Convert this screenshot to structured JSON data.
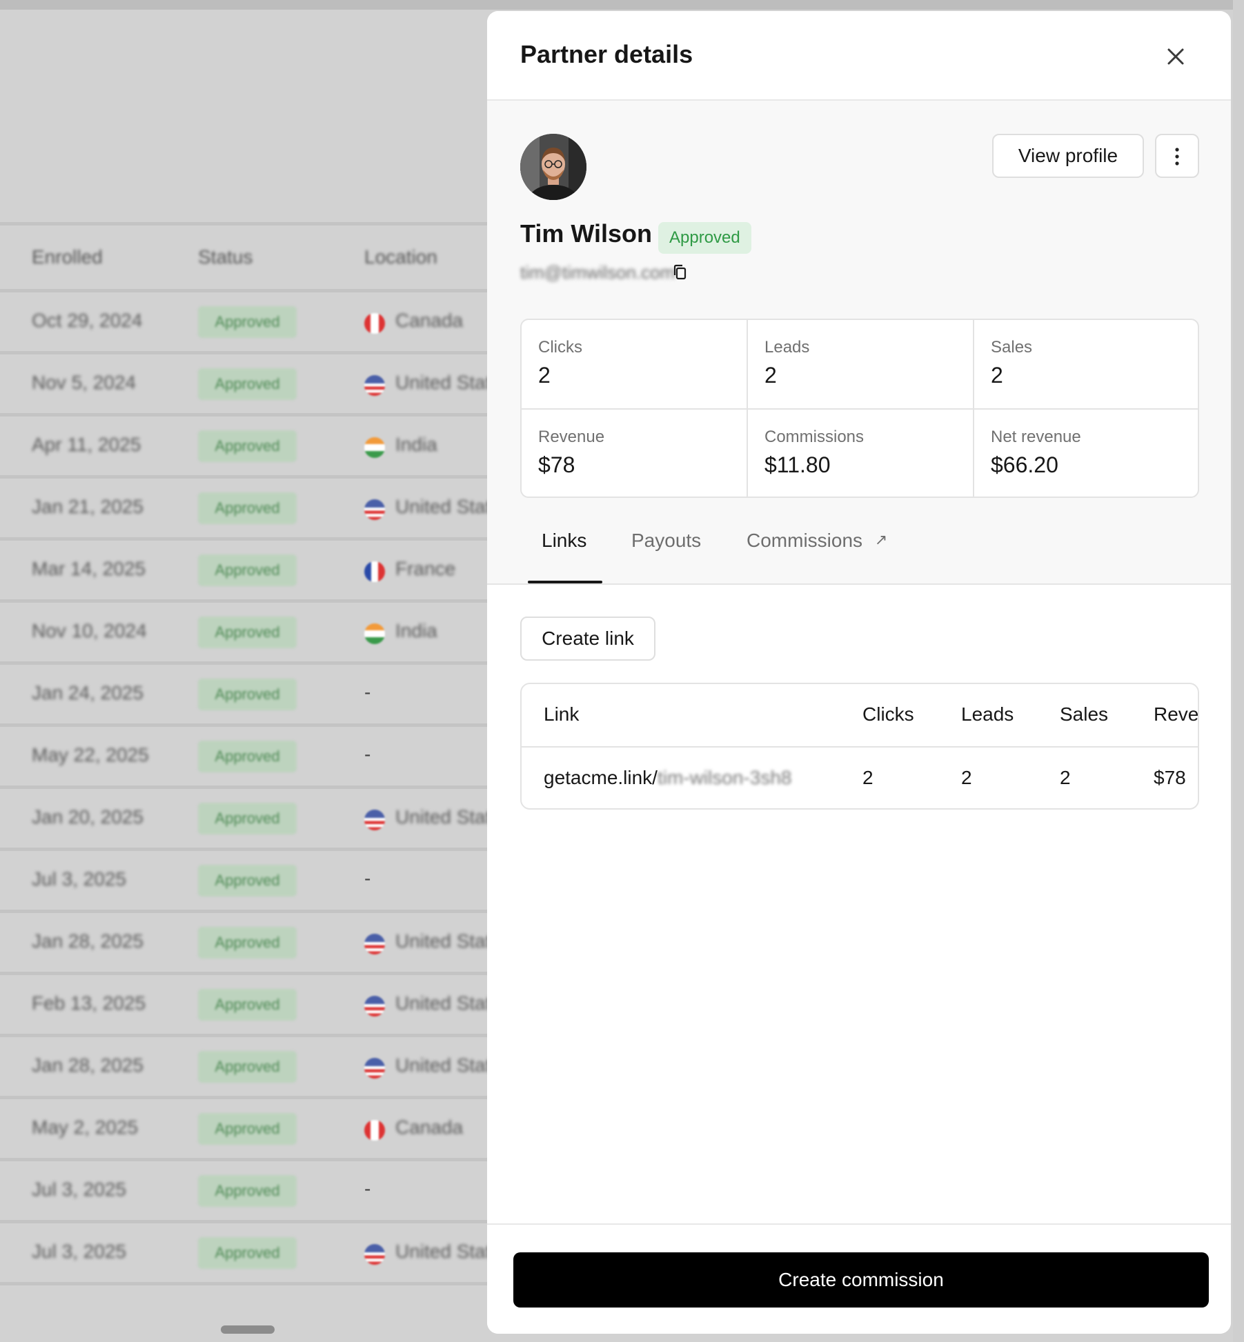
{
  "background_table": {
    "headers": [
      "Enrolled",
      "Status",
      "Location"
    ],
    "rows": [
      {
        "date": "Oct 29, 2024",
        "status": "Approved",
        "location": "Canada",
        "flag": "canada"
      },
      {
        "date": "Nov 5, 2024",
        "status": "Approved",
        "location": "United States",
        "flag": "us"
      },
      {
        "date": "Apr 11, 2025",
        "status": "Approved",
        "location": "India",
        "flag": "india"
      },
      {
        "date": "Jan 21, 2025",
        "status": "Approved",
        "location": "United States",
        "flag": "us"
      },
      {
        "date": "Mar 14, 2025",
        "status": "Approved",
        "location": "France",
        "flag": "france"
      },
      {
        "date": "Nov 10, 2024",
        "status": "Approved",
        "location": "India",
        "flag": "india"
      },
      {
        "date": "Jan 24, 2025",
        "status": "Approved",
        "location": "-",
        "flag": ""
      },
      {
        "date": "May 22, 2025",
        "status": "Approved",
        "location": "-",
        "flag": ""
      },
      {
        "date": "Jan 20, 2025",
        "status": "Approved",
        "location": "United States",
        "flag": "us"
      },
      {
        "date": "Jul 3, 2025",
        "status": "Approved",
        "location": "-",
        "flag": ""
      },
      {
        "date": "Jan 28, 2025",
        "status": "Approved",
        "location": "United States",
        "flag": "us"
      },
      {
        "date": "Feb 13, 2025",
        "status": "Approved",
        "location": "United States",
        "flag": "us"
      },
      {
        "date": "Jan 28, 2025",
        "status": "Approved",
        "location": "United States",
        "flag": "us"
      },
      {
        "date": "May 2, 2025",
        "status": "Approved",
        "location": "Canada",
        "flag": "canada"
      },
      {
        "date": "Jul 3, 2025",
        "status": "Approved",
        "location": "-",
        "flag": ""
      },
      {
        "date": "Jul 3, 2025",
        "status": "Approved",
        "location": "United States",
        "flag": "us"
      }
    ]
  },
  "panel": {
    "title": "Partner details",
    "close_icon": "close-icon",
    "partner": {
      "name": "Tim Wilson",
      "status": "Approved",
      "email": "tim@timwilson.com",
      "avatar": "avatar-photo"
    },
    "view_profile_label": "View profile",
    "more_icon": "more-vertical-icon",
    "copy_icon": "copy-icon",
    "stats": [
      {
        "label": "Clicks",
        "value": "2"
      },
      {
        "label": "Leads",
        "value": "2"
      },
      {
        "label": "Sales",
        "value": "2"
      },
      {
        "label": "Revenue",
        "value": "$78"
      },
      {
        "label": "Commissions",
        "value": "$11.80"
      },
      {
        "label": "Net revenue",
        "value": "$66.20"
      }
    ],
    "tabs": [
      {
        "label": "Links",
        "active": true
      },
      {
        "label": "Payouts",
        "active": false
      },
      {
        "label": "Commissions",
        "active": false,
        "external_icon": "↗"
      }
    ],
    "create_link_label": "Create link",
    "links_table": {
      "headers": [
        "Link",
        "Clicks",
        "Leads",
        "Sales",
        "Revenue"
      ],
      "rows": [
        {
          "domain": "getacme.link/",
          "slug": "tim-wilson-3sh8",
          "clicks": "2",
          "leads": "2",
          "sales": "2",
          "revenue": "$78"
        }
      ]
    },
    "create_commission_label": "Create commission"
  },
  "colors": {
    "approved_text": "#2f9a45",
    "approved_bg": "#dff1e2",
    "primary_button": "#000000"
  }
}
